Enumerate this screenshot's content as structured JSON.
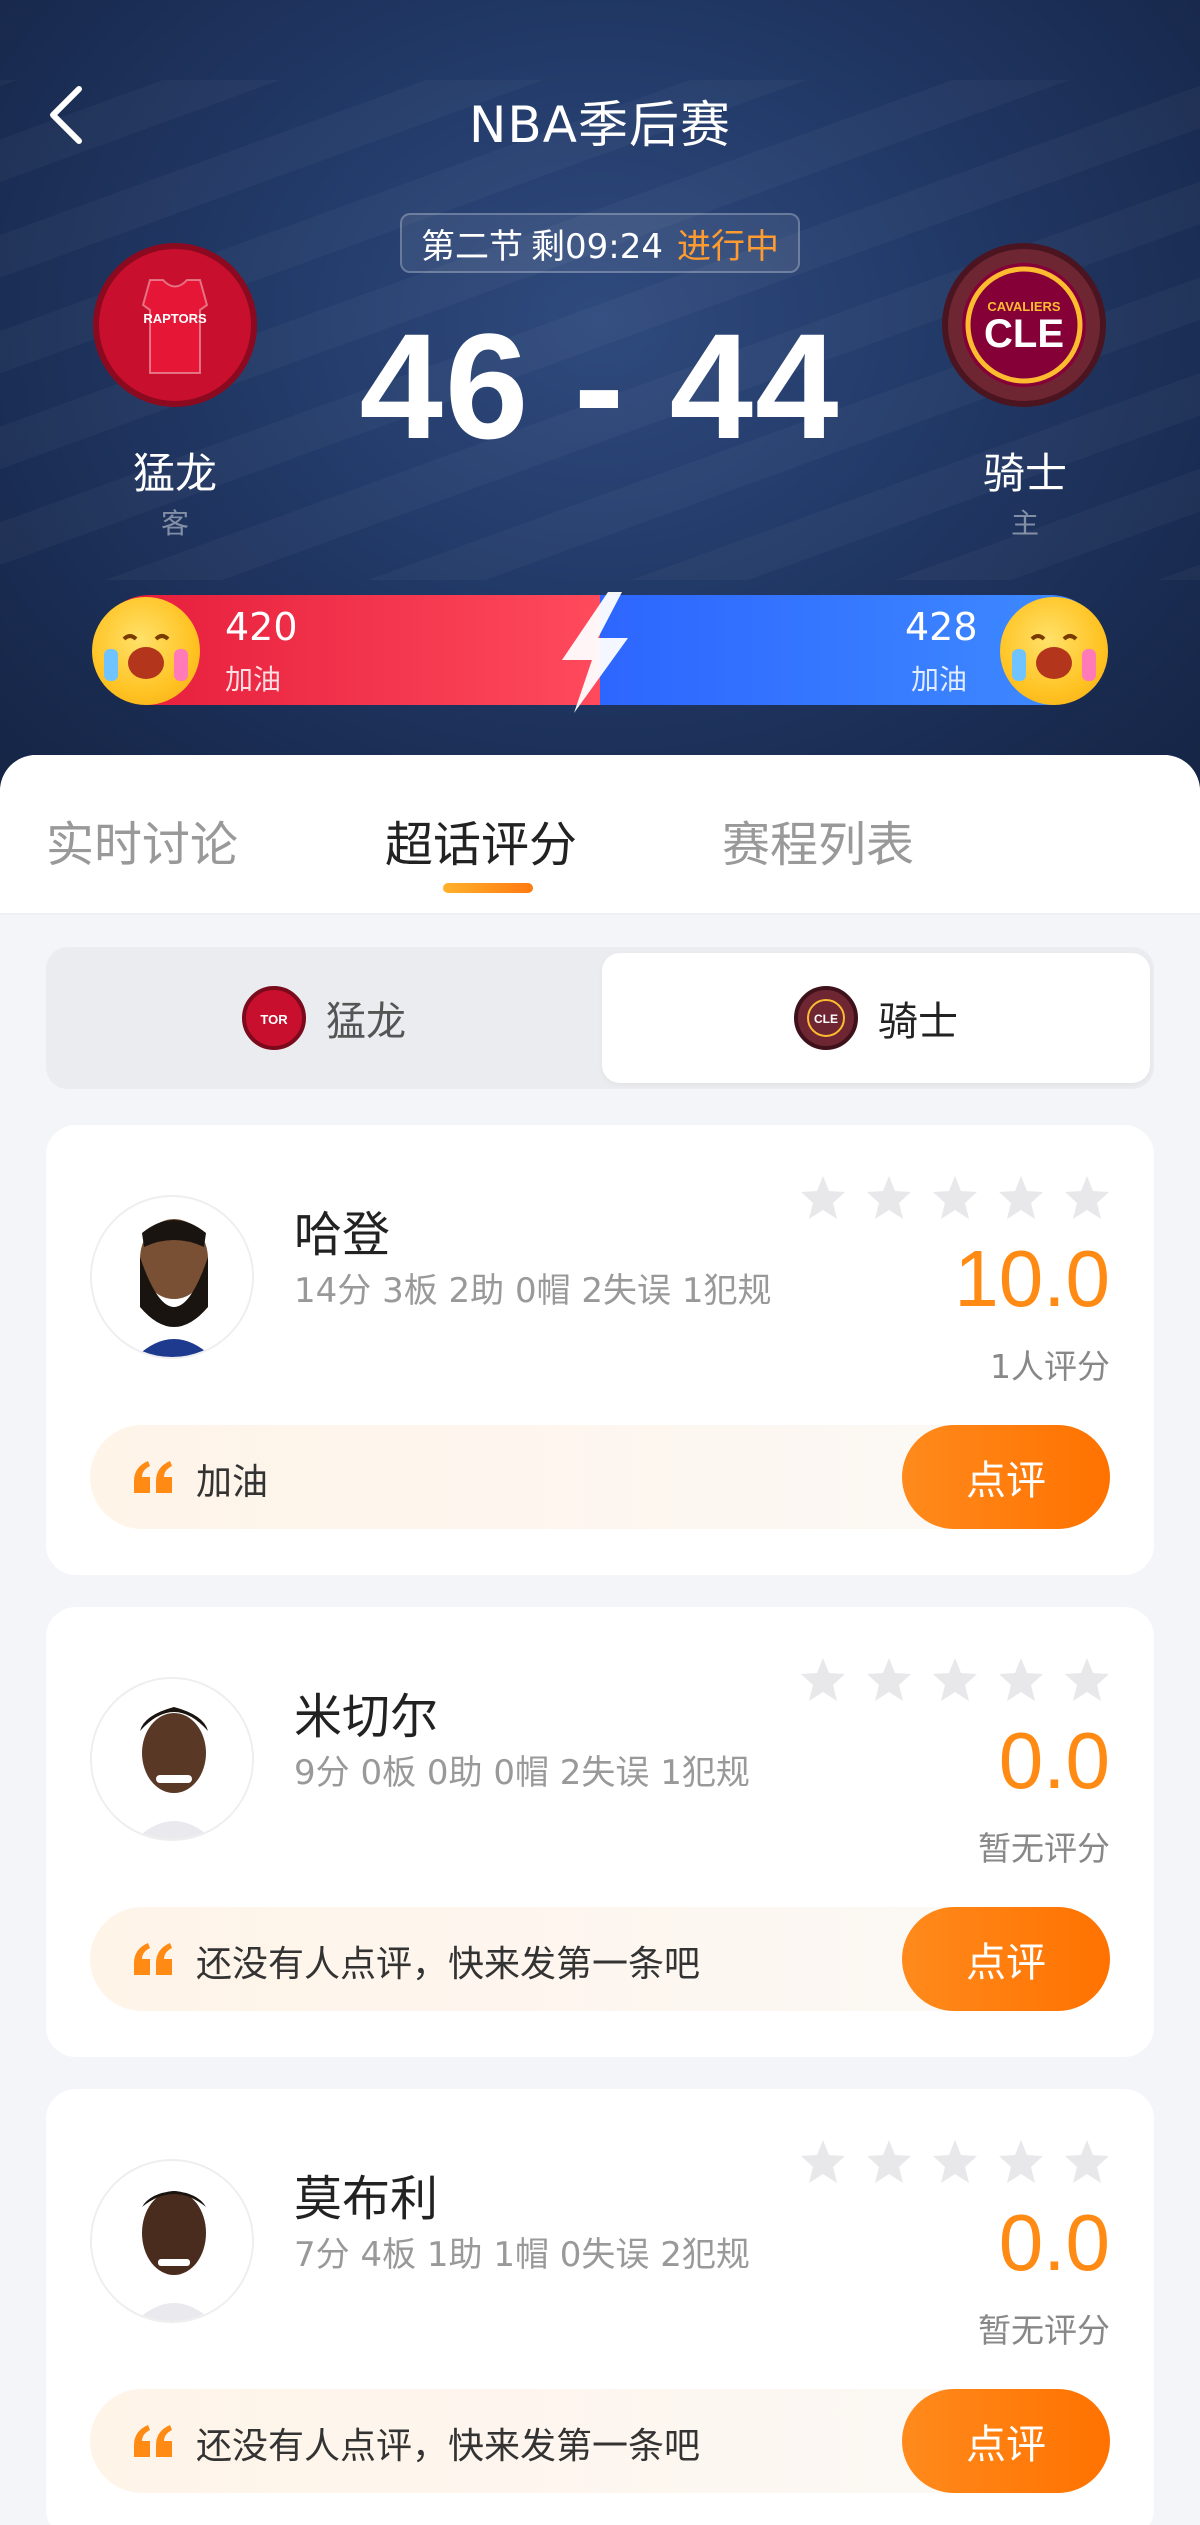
{
  "header": {
    "title": "NBA季后赛",
    "status": {
      "period": "第二节",
      "remaining": "剩09:24",
      "live": "进行中"
    },
    "score": "46 - 44",
    "away": {
      "name": "猛龙",
      "role": "客",
      "logo_text": "RAPTORS"
    },
    "home": {
      "name": "骑士",
      "role": "主",
      "logo_text_small": "CAVALIERS",
      "logo_text": "CLE"
    },
    "cheer": {
      "left_count": "420",
      "left_label": "加油",
      "right_count": "428",
      "right_label": "加油"
    }
  },
  "tabs": [
    {
      "label": "实时讨论"
    },
    {
      "label": "超话评分"
    },
    {
      "label": "赛程列表"
    }
  ],
  "team_switch": [
    {
      "label": "猛龙",
      "logo": "TOR"
    },
    {
      "label": "骑士",
      "logo": "CLE"
    }
  ],
  "players": [
    {
      "name": "哈登",
      "stats": "14分 3板 2助 0帽 2失误 1犯规",
      "rating": "10.0",
      "rating_count": "1人评分",
      "comment": "加油",
      "button": "点评"
    },
    {
      "name": "米切尔",
      "stats": "9分 0板 0助 0帽 2失误 1犯规",
      "rating": "0.0",
      "rating_count": "暂无评分",
      "comment": "还没有人点评，快来发第一条吧",
      "button": "点评"
    },
    {
      "name": "莫布利",
      "stats": "7分 4板 1助 1帽 0失误 2犯规",
      "rating": "0.0",
      "rating_count": "暂无评分",
      "comment": "还没有人点评，快来发第一条吧",
      "button": "点评"
    }
  ],
  "colors": {
    "accent_orange": "#ff8a14",
    "away_red": "#e41b3a",
    "home_blue": "#2d66ff",
    "header_navy": "#223a68"
  }
}
